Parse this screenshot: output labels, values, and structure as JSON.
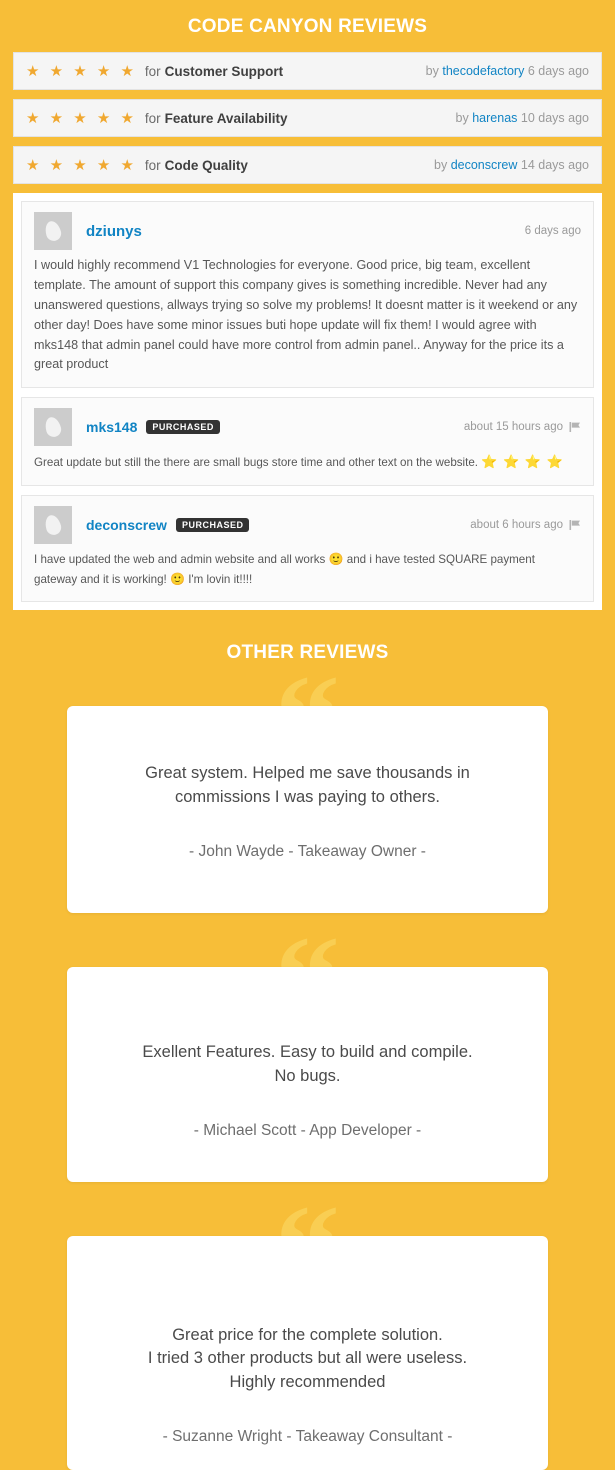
{
  "codecanyon": {
    "title": "CODE CANYON REVIEWS",
    "ratings": [
      {
        "stars": "★ ★ ★ ★ ★",
        "for_label": "for",
        "category": "Customer Support",
        "by_label": "by",
        "user": "thecodefactory",
        "when": "6 days ago"
      },
      {
        "stars": "★ ★ ★ ★ ★",
        "for_label": "for",
        "category": "Feature Availability",
        "by_label": "by",
        "user": "harenas",
        "when": "10 days ago"
      },
      {
        "stars": "★ ★ ★ ★ ★",
        "for_label": "for",
        "category": "Code Quality",
        "by_label": "by",
        "user": "deconscrew",
        "when": "14 days ago"
      }
    ],
    "reviews": [
      {
        "user": "dziunys",
        "badge": "",
        "when": "6 days ago",
        "has_flag": false,
        "text": "I would highly recommend V1 Technologies for everyone. Good price, big team, excellent template. The amount of support this company gives is something incredible. Never had any unanswered questions, allways trying so solve my problems! It doesnt matter is it weekend or any other day! Does have some minor issues buti hope update will fix them! I would agree with mks148 that admin panel could have more control from admin panel.. Anyway for the price its a great product"
      },
      {
        "user": "mks148",
        "badge": "PURCHASED",
        "when": "about 15 hours ago",
        "has_flag": true,
        "text": "Great update but still the there are small bugs store time and other text on the website.",
        "trailing_stars": "⭐ ⭐ ⭐ ⭐"
      },
      {
        "user": "deconscrew",
        "badge": "PURCHASED",
        "when": "about 6 hours ago",
        "has_flag": true,
        "text_part1": "I have updated the web and admin website and all works",
        "emoji1": "🙂",
        "text_part2": "and i have tested SQUARE payment gateway and it is working!",
        "emoji2": "🙂",
        "text_part3": "I'm lovin it!!!!"
      }
    ]
  },
  "other_reviews": {
    "title": "OTHER REVIEWS",
    "quote_glyph": "“",
    "testimonials": [
      {
        "quote": "Great system. Helped me save thousands in\ncommissions I was paying to others.",
        "author": "- John Wayde - Takeaway Owner -"
      },
      {
        "quote": "Exellent Features. Easy to build and compile.\nNo bugs.",
        "author": "- Michael Scott - App Developer -"
      },
      {
        "quote": "Great price for the complete solution.\nI tried 3 other products but all were useless.\nHighly recommended",
        "author": "- Suzanne Wright - Takeaway Consultant -"
      }
    ]
  },
  "colors": {
    "background": "#f7be38",
    "quote_mark": "#f9ce53",
    "link": "#1184c4",
    "star": "#f0a830",
    "badge": "#333333",
    "card": "#ffffff"
  }
}
